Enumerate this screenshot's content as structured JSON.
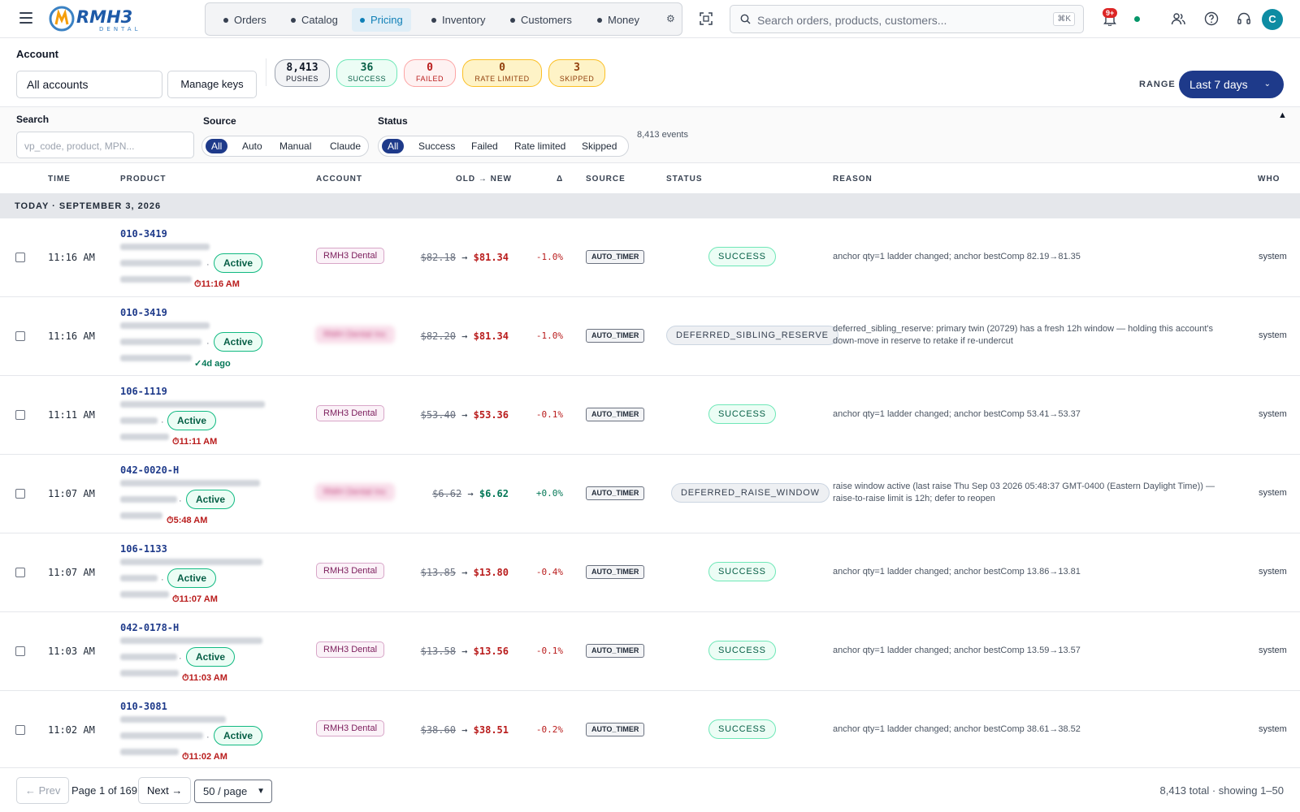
{
  "app": {
    "logo_text": "RMH3",
    "logo_sub": "DENTAL",
    "nav": [
      {
        "label": "Orders"
      },
      {
        "label": "Catalog"
      },
      {
        "label": "Pricing"
      },
      {
        "label": "Inventory"
      },
      {
        "label": "Customers"
      },
      {
        "label": "Money"
      }
    ],
    "active_nav": "Pricing",
    "search_placeholder": "Search orders, products, customers...",
    "search_shortcut": "⌘K",
    "notif_badge": "9+",
    "avatar_initial": "C",
    "colors": {
      "brand": "#1e3a8a",
      "accent": "#0e7fb6",
      "success": "#059669",
      "danger": "#dc2626"
    }
  },
  "account": {
    "label": "Account",
    "selected": "All accounts",
    "manage_keys": "Manage keys",
    "stats": [
      {
        "value": "8,413",
        "label": "PUSHES"
      },
      {
        "value": "36",
        "label": "SUCCESS"
      },
      {
        "value": "0",
        "label": "FAILED"
      },
      {
        "value": "0",
        "label": "RATE LIMITED"
      },
      {
        "value": "3",
        "label": "SKIPPED"
      }
    ],
    "range_label": "RANGE",
    "range_value": "Last 7 days"
  },
  "filters": {
    "search_label": "Search",
    "search_placeholder": "vp_code, product, MPN...",
    "source_label": "Source",
    "source_options": [
      "All",
      "Auto",
      "Manual",
      "Claude"
    ],
    "source_selected": "All",
    "status_label": "Status",
    "status_options": [
      "All",
      "Success",
      "Failed",
      "Rate limited",
      "Skipped"
    ],
    "status_selected": "All",
    "event_count": "8,413 events",
    "collapse_icon": "▲"
  },
  "table": {
    "headers": {
      "time": "TIME",
      "product": "PRODUCT",
      "account": "ACCOUNT",
      "old_new": "OLD → NEW",
      "delta": "Δ",
      "source": "SOURCE",
      "status": "STATUS",
      "reason": "REASON",
      "who": "WHO"
    },
    "day_label": "TODAY · SEPTEMBER 3, 2026",
    "rows": [
      {
        "time": "11:16 AM",
        "sku": "010-3419",
        "active": "Active",
        "clock": "⏱11:16 AM",
        "account": "RMH3 Dental",
        "old": "$82.18",
        "new": "$81.34",
        "delta": "-1.0%",
        "source": "AUTO_TIMER",
        "status": "SUCCESS",
        "reason": "anchor qty=1 ladder changed; anchor bestComp 82.19→81.35",
        "who": "system"
      },
      {
        "time": "11:16 AM",
        "sku": "010-3419",
        "active": "Active",
        "clock": "✓4d ago",
        "account": "RMH Dental Inc",
        "old": "$82.20",
        "new": "$81.34",
        "delta": "-1.0%",
        "source": "AUTO_TIMER",
        "status": "DEFERRED_SIBLING_RESERVE",
        "reason": "deferred_sibling_reserve: primary twin (20729) has a fresh 12h window — holding this account's down-move in reserve to retake if re-undercut",
        "who": "system"
      },
      {
        "time": "11:11 AM",
        "sku": "106-1119",
        "active": "Active",
        "clock": "⏱11:11 AM",
        "account": "RMH3 Dental",
        "old": "$53.40",
        "new": "$53.36",
        "delta": "-0.1%",
        "source": "AUTO_TIMER",
        "status": "SUCCESS",
        "reason": "anchor qty=1 ladder changed; anchor bestComp 53.41→53.37",
        "who": "system"
      },
      {
        "time": "11:07 AM",
        "sku": "042-0020-H",
        "active": "Active",
        "clock": "⏱5:48 AM",
        "account": "RMH Dental Inc",
        "old": "$6.62",
        "new": "$6.62",
        "delta": "+0.0%",
        "source": "AUTO_TIMER",
        "status": "DEFERRED_RAISE_WINDOW",
        "reason": "raise window active (last raise Thu Sep 03 2026 05:48:37 GMT-0400 (Eastern Daylight Time)) — raise-to-raise limit is 12h; defer to reopen",
        "who": "system"
      },
      {
        "time": "11:07 AM",
        "sku": "106-1133",
        "active": "Active",
        "clock": "⏱11:07 AM",
        "account": "RMH3 Dental",
        "old": "$13.85",
        "new": "$13.80",
        "delta": "-0.4%",
        "source": "AUTO_TIMER",
        "status": "SUCCESS",
        "reason": "anchor qty=1 ladder changed; anchor bestComp 13.86→13.81",
        "who": "system"
      },
      {
        "time": "11:03 AM",
        "sku": "042-0178-H",
        "active": "Active",
        "clock": "⏱11:03 AM",
        "account": "RMH3 Dental",
        "old": "$13.58",
        "new": "$13.56",
        "delta": "-0.1%",
        "source": "AUTO_TIMER",
        "status": "SUCCESS",
        "reason": "anchor qty=1 ladder changed; anchor bestComp 13.59→13.57",
        "who": "system"
      },
      {
        "time": "11:02 AM",
        "sku": "010-3081",
        "active": "Active",
        "clock": "⏱11:02 AM",
        "account": "RMH3 Dental",
        "old": "$38.60",
        "new": "$38.51",
        "delta": "-0.2%",
        "source": "AUTO_TIMER",
        "status": "SUCCESS",
        "reason": "anchor qty=1 ladder changed; anchor bestComp 38.61→38.52",
        "who": "system"
      }
    ]
  },
  "pager": {
    "prev": "← Prev",
    "page_text": "Page 1 of 169",
    "next": "Next →",
    "page_size": "50 / page",
    "total": "8,413 total · showing 1–50"
  }
}
